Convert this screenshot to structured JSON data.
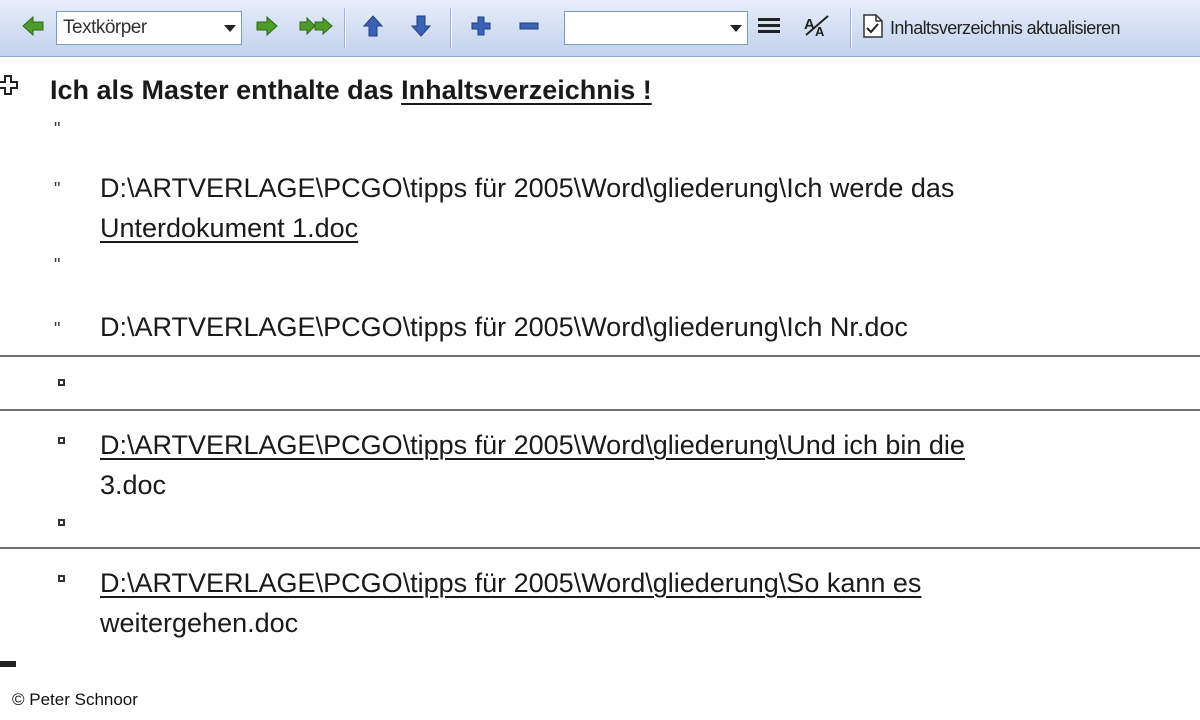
{
  "toolbar": {
    "style_value": "Textkörper",
    "style2_value": "",
    "update_toc_label": "Inhaltsverzeichnis aktualisieren"
  },
  "document": {
    "master_heading_prefix": "Ich als Master enthalte das ",
    "master_heading_link": "Inhaltsverzeichnis !",
    "quote_mark": "\"",
    "subdoc1_line1": "D:\\ARTVERLAGE\\PCGO\\tipps für 2005\\Word\\gliederung\\Ich werde das",
    "subdoc1_line2": "Unterdokument 1.doc",
    "subdoc2_line1": "D:\\ARTVERLAGE\\PCGO\\tipps für 2005\\Word\\gliederung\\Ich Nr.doc",
    "subdoc3_line1": "D:\\ARTVERLAGE\\PCGO\\tipps für 2005\\Word\\gliederung\\Und ich bin die",
    "subdoc3_line2": "3.doc",
    "subdoc4_line1": "D:\\ARTVERLAGE\\PCGO\\tipps für 2005\\Word\\gliederung\\So kann es",
    "subdoc4_line2": "weitergehen.doc"
  },
  "credit": "© Peter Schnoor",
  "colors": {
    "toolbar_top": "#e7eefa",
    "toolbar_bottom": "#c3d2ec",
    "arrow_green": "#4e9a2a",
    "arrow_blue": "#3a62b5"
  }
}
